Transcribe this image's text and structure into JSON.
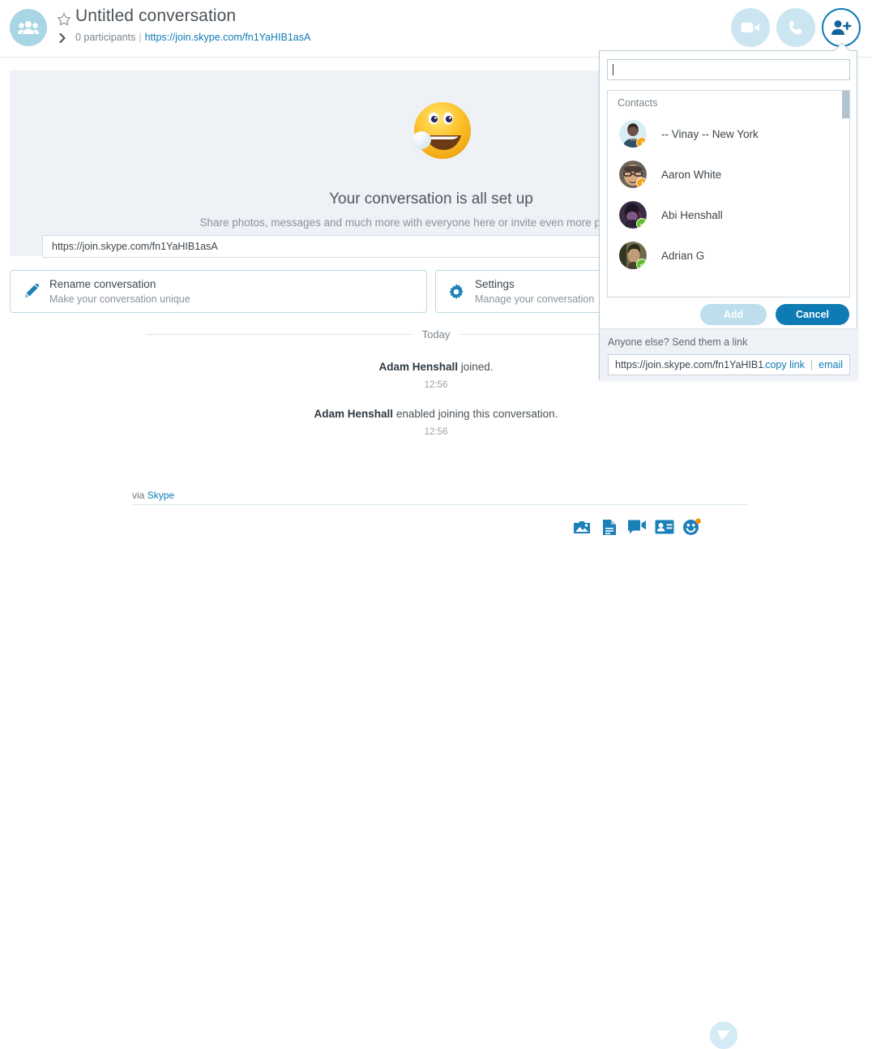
{
  "header": {
    "title": "Untitled conversation",
    "participants": "0 participants",
    "separator": "|",
    "join_link": "https://join.skype.com/fn1YaHIB1asA",
    "avatar_icon": "group-icon",
    "star_icon": "star-icon",
    "chevron_icon": "chevron-right-icon",
    "video_icon": "video-call-icon",
    "call_icon": "audio-call-icon",
    "add_people_icon": "add-person-icon",
    "accent_color": "#0f7bb5",
    "avatar_color": "#a9d6e5",
    "button_bg": "#cbe6f0"
  },
  "welcome": {
    "emoji_icon": "wave-smiley-emoji",
    "title": "Your conversation is all set up",
    "subtitle": "Share photos, messages and much more with everyone here or invite even more people by sha",
    "link_value": "https://join.skype.com/fn1YaHIB1asA",
    "panel_color": "#eef1f6"
  },
  "cards": [
    {
      "icon": "pencil-icon",
      "title": "Rename conversation",
      "subtitle": "Make your conversation unique"
    },
    {
      "icon": "gear-icon",
      "title": "Settings",
      "subtitle": "Manage your conversation"
    }
  ],
  "timeline": {
    "day_label": "Today",
    "messages": [
      {
        "actor": "Adam Henshall",
        "text": " joined.",
        "time": "12:56"
      },
      {
        "actor": "Adam Henshall",
        "text": " enabled joining this conversation.",
        "time": "12:56"
      }
    ],
    "via_prefix": "via ",
    "via_link": "Skype"
  },
  "composer": {
    "tools": [
      {
        "icon": "photo-icon",
        "label": "Send photo"
      },
      {
        "icon": "file-icon",
        "label": "Send file"
      },
      {
        "icon": "video-message-icon",
        "label": "Send video message"
      },
      {
        "icon": "contact-card-icon",
        "label": "Send contact"
      },
      {
        "icon": "emoticon-icon",
        "label": "Emoticons"
      }
    ],
    "send_icon": "send-icon"
  },
  "popup": {
    "search_value": "",
    "search_placeholder": "",
    "contacts_header": "Contacts",
    "contacts": [
      {
        "name": "-- Vinay -- New York",
        "status": "away",
        "status_icon": "clock-badge-icon"
      },
      {
        "name": "Aaron White",
        "status": "away",
        "status_icon": "clock-badge-icon"
      },
      {
        "name": "Abi Henshall",
        "status": "online",
        "status_icon": "check-badge-icon"
      },
      {
        "name": "Adrian G",
        "status": "online",
        "status_icon": "check-badge-icon"
      }
    ],
    "add_label": "Add",
    "cancel_label": "Cancel",
    "add_disabled_color": "#bedeed",
    "cancel_color": "#0f7bb5",
    "footer_label": "Anyone else? Send them a link",
    "footer_url": "https://join.skype.com/fn1YaHIB1...",
    "copy_link_label": "copy link",
    "footer_pipe": "|",
    "email_label": "email"
  }
}
